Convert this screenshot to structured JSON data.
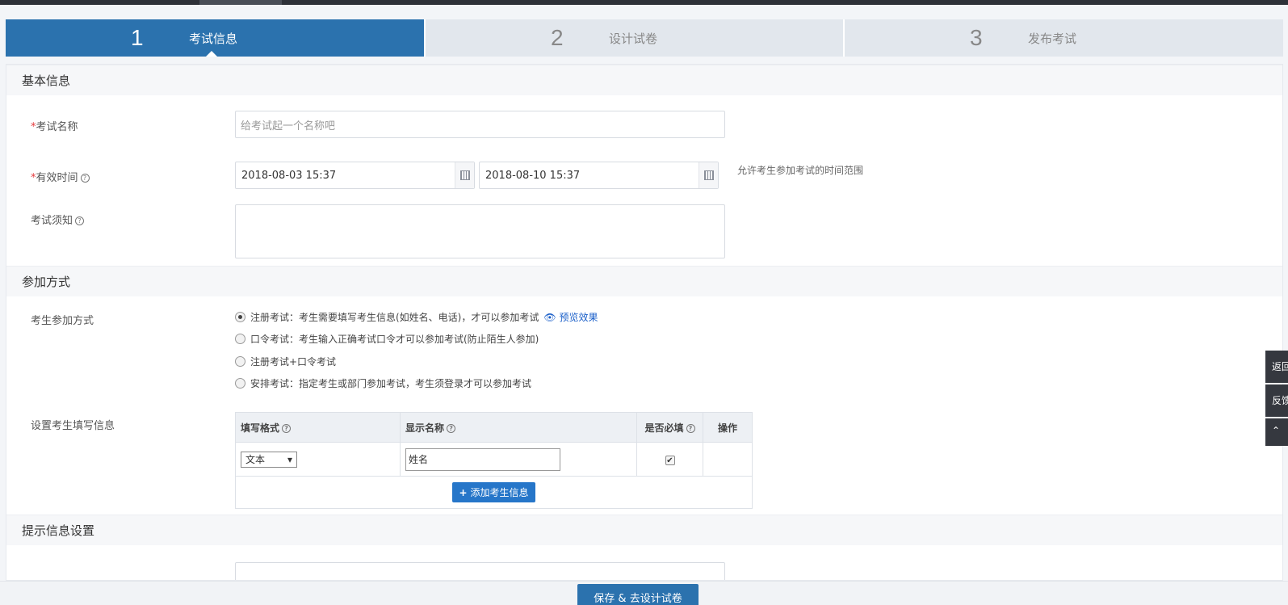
{
  "steps": [
    {
      "num": "1",
      "label": "考试信息",
      "active": true
    },
    {
      "num": "2",
      "label": "设计试卷",
      "active": false
    },
    {
      "num": "3",
      "label": "发布考试",
      "active": false
    }
  ],
  "sections": {
    "basic": "基本信息",
    "join": "参加方式",
    "tips": "提示信息设置"
  },
  "form": {
    "name_label": "考试名称",
    "name_placeholder": "给考试起一个名称吧",
    "time_label": "有效时间",
    "start_time": "2018-08-03 15:37",
    "end_time": "2018-08-10 15:37",
    "time_hint": "允许考生参加考试的时间范围",
    "notice_label": "考试须知",
    "required_mark": "*"
  },
  "join": {
    "mode_label": "考生参加方式",
    "options": [
      {
        "label": "注册考试：考生需要填写考生信息(如姓名、电话)，才可以参加考试",
        "checked": true
      },
      {
        "label": "口令考试：考生输入正确考试口令才可以参加考试(防止陌生人参加)",
        "checked": false
      },
      {
        "label": "注册考试+口令考试",
        "checked": false
      },
      {
        "label": "安排考试：指定考生或部门参加考试，考生须登录才可以参加考试",
        "checked": false
      }
    ],
    "preview_link": "预览效果",
    "info_label": "设置考生填写信息"
  },
  "info_table": {
    "headers": {
      "format": "填写格式",
      "display_name": "显示名称",
      "required": "是否必填",
      "ops": "操作"
    },
    "rows": [
      {
        "format": "文本",
        "display_name": "姓名",
        "required": true
      }
    ],
    "add_button": "添加考生信息"
  },
  "footer": {
    "save_button": "保存 & 去设计试卷"
  },
  "side": {
    "back": "返回",
    "feedback": "反馈"
  }
}
